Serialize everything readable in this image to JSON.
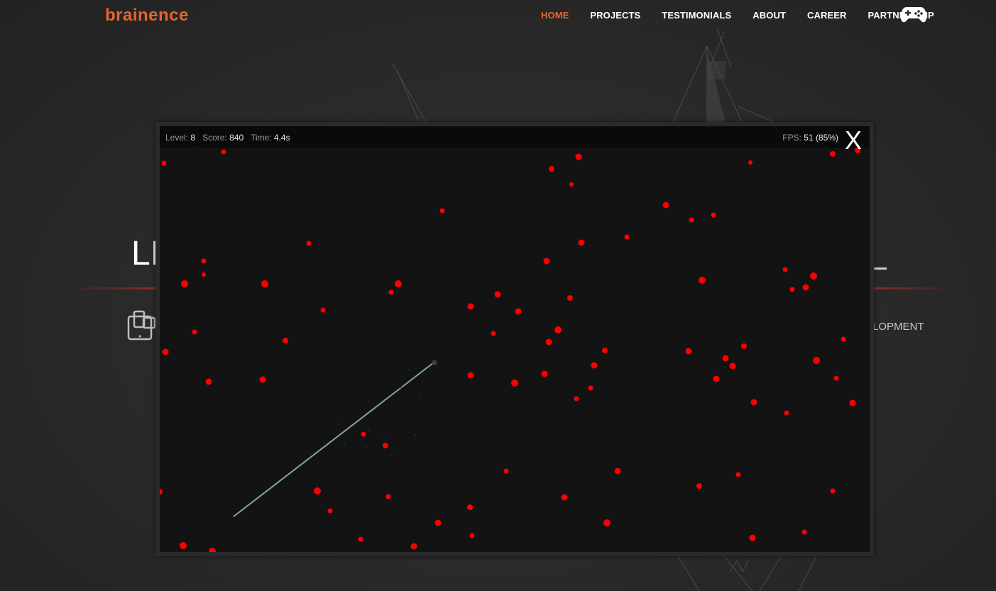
{
  "header": {
    "logo_text": "brainence",
    "brand_color": "#e8652b",
    "nav": [
      {
        "label": "HOME",
        "active": true
      },
      {
        "label": "PROJECTS",
        "active": false
      },
      {
        "label": "TESTIMONIALS",
        "active": false
      },
      {
        "label": "ABOUT",
        "active": false
      },
      {
        "label": "CAREER",
        "active": false
      },
      {
        "label": "PARTNERSHIP",
        "active": false
      }
    ],
    "game_icon": "gamepad-icon"
  },
  "hero": {
    "partial_title": "LI",
    "partial_service_text": "LOPMENT",
    "device_icon": "devices-icon"
  },
  "game": {
    "hud": {
      "level_label": "Level:",
      "level_value": "8",
      "score_label": "Score:",
      "score_value": "840",
      "time_label": "Time:",
      "time_value": "4.4s",
      "fps_label": "FPS:",
      "fps_value": "51 (85%)"
    },
    "close_label": "X",
    "dot_color": "#ff0000",
    "trail_color": "#7fa6ad",
    "background_color": "#131313"
  }
}
